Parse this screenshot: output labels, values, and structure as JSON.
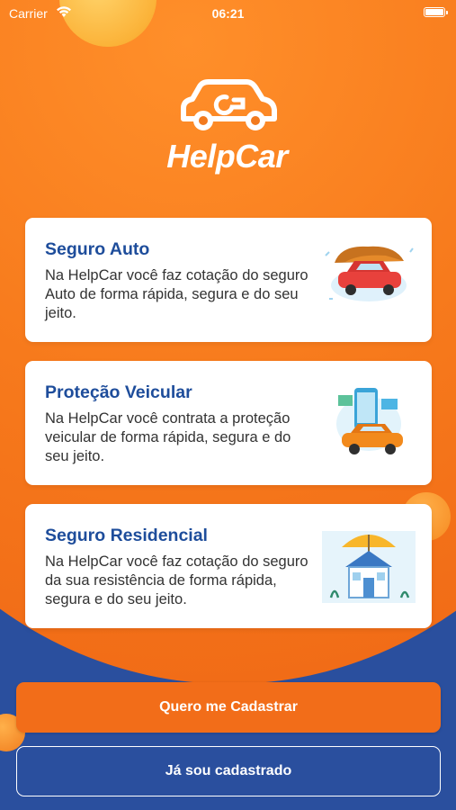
{
  "status_bar": {
    "carrier": "Carrier",
    "time": "06:21"
  },
  "brand": {
    "name": "HelpCar"
  },
  "cards": [
    {
      "title": "Seguro Auto",
      "description": "Na HelpCar você faz cotação do seguro Auto de forma rápida, segura e do seu jeito.",
      "illustration": "car-umbrella-icon"
    },
    {
      "title": "Proteção Veicular",
      "description": "Na HelpCar você contrata a proteção veicular de forma rápida, segura e do seu jeito.",
      "illustration": "car-phone-icon"
    },
    {
      "title": "Seguro Residencial",
      "description": "Na HelpCar você faz cotação do seguro da sua resistência de forma rápida, segura e do seu jeito.",
      "illustration": "house-umbrella-icon"
    }
  ],
  "buttons": {
    "register": "Quero me Cadastrar",
    "login": "Já sou cadastrado"
  },
  "colors": {
    "orange": "#f26d19",
    "blue": "#2a4f9e",
    "title_blue": "#1e4d9b"
  }
}
